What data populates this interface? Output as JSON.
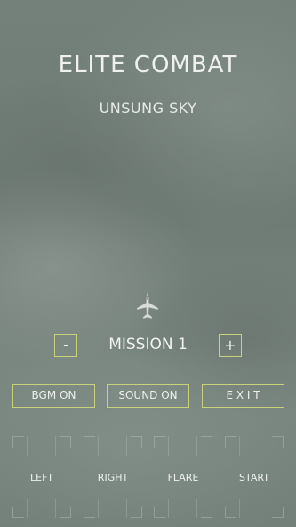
{
  "game": {
    "title": "ELITE COMBAT",
    "subtitle": "UNSUNG SKY"
  },
  "mission": {
    "decrement_label": "-",
    "label": "MISSION 1",
    "increment_label": "+"
  },
  "options": {
    "bgm_label": "BGM ON",
    "sound_label": "SOUND ON",
    "exit_label": "E X I T"
  },
  "controls": {
    "left_label": "LEFT",
    "right_label": "RIGHT",
    "flare_label": "FLARE",
    "start_label": "START"
  },
  "colors": {
    "button_border": "#c9d27a",
    "text": "#eef1ee",
    "background": "#6f7a74"
  },
  "icons": {
    "player": "fighter-jet-icon"
  }
}
